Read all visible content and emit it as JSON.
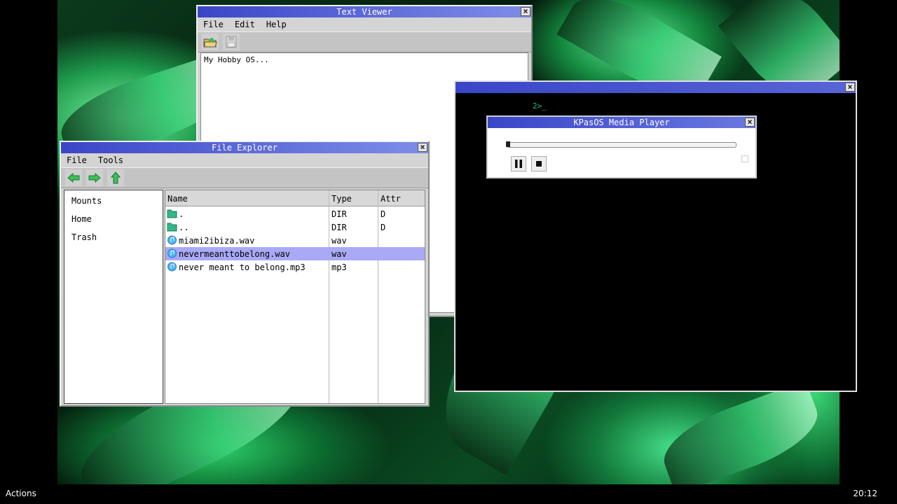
{
  "text_viewer": {
    "title": "Text Viewer",
    "menu": [
      "File",
      "Edit",
      "Help"
    ],
    "content": "My Hobby OS..."
  },
  "console": {
    "title": "",
    "prompt": "2>_"
  },
  "media_player": {
    "title": "KPasOS Media Player",
    "progress": 0.0
  },
  "file_explorer": {
    "title": "File Explorer",
    "menu": [
      "File",
      "Tools"
    ],
    "sidebar": [
      "Mounts",
      "Home",
      "Trash"
    ],
    "columns": [
      "Name",
      "Type",
      "Attr"
    ],
    "files": [
      {
        "name": ".",
        "type": "DIR",
        "attr": "D",
        "icon": "folder-icon"
      },
      {
        "name": "..",
        "type": "DIR",
        "attr": "D",
        "icon": "folder-icon"
      },
      {
        "name": "miami2ibiza.wav",
        "type": "wav",
        "attr": "",
        "icon": "audio-file-icon"
      },
      {
        "name": "nevermeanttobelong.wav",
        "type": "wav",
        "attr": "",
        "icon": "audio-file-icon",
        "selected": true
      },
      {
        "name": "never meant to belong.mp3",
        "type": "mp3",
        "attr": "",
        "icon": "audio-file-icon"
      }
    ]
  },
  "taskbar": {
    "actions_label": "Actions",
    "clock": "20:12"
  },
  "colors": {
    "titlebar_start": "#3a46c8",
    "titlebar_end": "#7f8de8",
    "selection": "#a9a9f6",
    "console_text": "#20c070",
    "nav_arrows": "#3bbf5a"
  }
}
